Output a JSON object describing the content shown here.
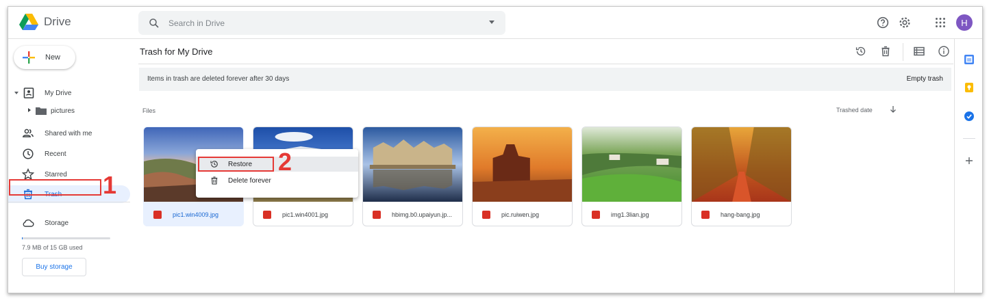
{
  "app": {
    "name": "Drive"
  },
  "search": {
    "placeholder": "Search in Drive"
  },
  "header": {
    "avatar_initial": "H",
    "avatar_color": "#7e57c2"
  },
  "sidebar": {
    "new_label": "New",
    "items": [
      {
        "label": "My Drive",
        "icon": "my-drive-icon"
      },
      {
        "label": "pictures",
        "icon": "folder-icon"
      },
      {
        "label": "Shared with me",
        "icon": "shared-icon"
      },
      {
        "label": "Recent",
        "icon": "clock-icon"
      },
      {
        "label": "Starred",
        "icon": "star-icon"
      },
      {
        "label": "Trash",
        "icon": "trash-icon",
        "active": true
      },
      {
        "label": "Storage",
        "icon": "cloud-icon"
      }
    ],
    "storage_used": "7.9 MB of 15 GB used",
    "storage_fraction": 0.0005,
    "buy_storage": "Buy storage"
  },
  "main": {
    "title": "Trash for My Drive",
    "banner_message": "Items in trash are deleted forever after 30 days",
    "empty_trash": "Empty trash",
    "files_label": "Files",
    "sort_label": "Trashed date"
  },
  "files": [
    {
      "name": "pic1.win4009.jpg",
      "selected": true
    },
    {
      "name": "pic1.win4001.jpg",
      "selected": false
    },
    {
      "name": "hbimg.b0.upaiyun.jp...",
      "selected": false
    },
    {
      "name": "pic.ruiwen.jpg",
      "selected": false
    },
    {
      "name": "img1.3lian.jpg",
      "selected": false
    },
    {
      "name": "hang-bang.jpg",
      "selected": false
    }
  ],
  "context_menu": {
    "restore": "Restore",
    "delete_forever": "Delete forever"
  },
  "annotations": {
    "step1": "1",
    "step2": "2"
  },
  "colors": {
    "accent": "#1a73e8",
    "annotation": "#e53935",
    "active_bg": "#e8f0fe"
  }
}
